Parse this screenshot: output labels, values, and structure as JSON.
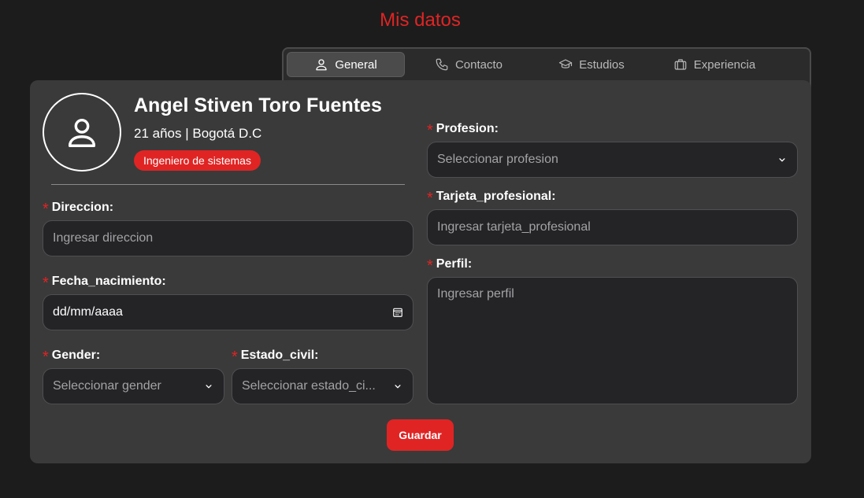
{
  "page": {
    "title": "Mis datos"
  },
  "tabs": [
    {
      "label": "General",
      "icon": "user-icon",
      "active": true
    },
    {
      "label": "Contacto",
      "icon": "phone-icon",
      "active": false
    },
    {
      "label": "Estudios",
      "icon": "graduation-cap-icon",
      "active": false
    },
    {
      "label": "Experiencia",
      "icon": "briefcase-icon",
      "active": false
    }
  ],
  "profile": {
    "name": "Angel Stiven Toro Fuentes",
    "meta": "21 años | Bogotá D.C",
    "badge": "Ingeniero de sistemas",
    "avatar_icon": "user-icon"
  },
  "form": {
    "direccion": {
      "label": "Direccion:",
      "placeholder": "Ingresar direccion"
    },
    "fecha_nacimiento": {
      "label": "Fecha_nacimiento:",
      "value": "dd/mm/aaaa",
      "icon": "calendar-icon"
    },
    "gender": {
      "label": "Gender:",
      "placeholder": "Seleccionar gender"
    },
    "estado_civil": {
      "label": "Estado_civil:",
      "placeholder": "Seleccionar estado_ci..."
    },
    "profesion": {
      "label": "Profesion:",
      "placeholder": "Seleccionar profesion"
    },
    "tarjeta_profesional": {
      "label": "Tarjeta_profesional:",
      "placeholder": "Ingresar tarjeta_profesional"
    },
    "perfil": {
      "label": "Perfil:",
      "placeholder": "Ingresar perfil"
    },
    "required_mark": "*"
  },
  "actions": {
    "save_label": "Guardar"
  },
  "colors": {
    "accent": "#e02424",
    "background": "#1c1c1c",
    "card": "#3a3a3a",
    "input": "#242427"
  }
}
